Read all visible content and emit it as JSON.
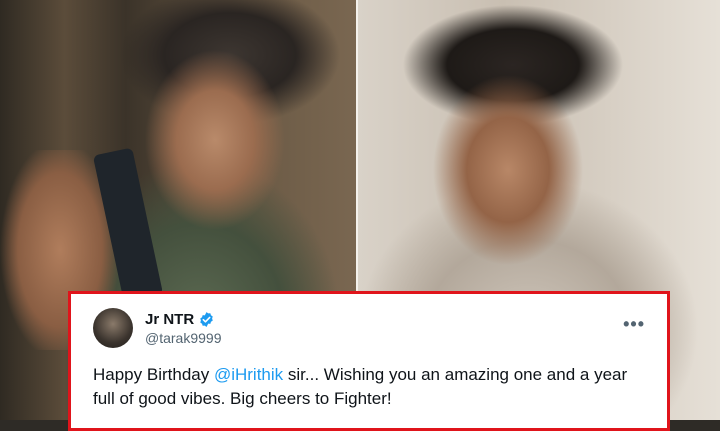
{
  "tweet": {
    "display_name": "Jr NTR",
    "handle": "@tarak9999",
    "text_before": "Happy Birthday ",
    "mention": "@iHrithik",
    "text_after": " sir... Wishing you an amazing one and a year full of good vibes. Big cheers to Fighter!",
    "verified_color": "#1d9bf0",
    "border_color": "#e0141b",
    "more_icon": "more-dots-icon"
  }
}
